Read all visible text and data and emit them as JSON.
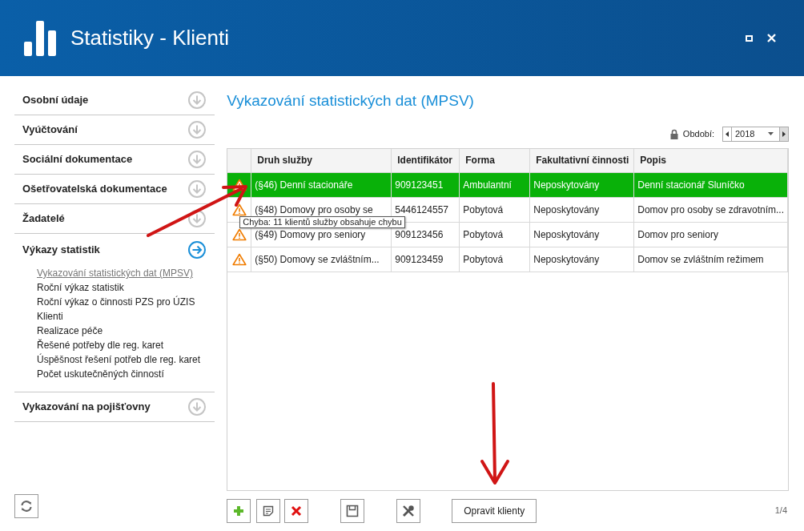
{
  "window": {
    "title": "Statistiky - Klienti"
  },
  "sidebar": {
    "sections": [
      {
        "title": "Osobní údaje",
        "expanded": false
      },
      {
        "title": "Vyúčtování",
        "expanded": false
      },
      {
        "title": "Sociální dokumentace",
        "expanded": false
      },
      {
        "title": "Ošetřovatelská dokumentace",
        "expanded": false
      },
      {
        "title": "Žadatelé",
        "expanded": false
      },
      {
        "title": "Výkazy statistik",
        "expanded": true,
        "items": [
          {
            "label": "Vykazování statistických dat (MPSV)",
            "selected": true
          },
          {
            "label": "Roční výkaz statistik",
            "selected": false
          },
          {
            "label": "Roční výkaz o činnosti PZS pro ÚZIS",
            "selected": false
          },
          {
            "label": "Klienti",
            "selected": false
          },
          {
            "label": "Realizace péče",
            "selected": false
          },
          {
            "label": "Řešené potřeby dle reg. karet",
            "selected": false
          },
          {
            "label": "Úspěšnost řešení potřeb dle reg. karet",
            "selected": false
          },
          {
            "label": "Počet uskutečněných činností",
            "selected": false
          }
        ]
      },
      {
        "title": "Vykazování na pojišťovny",
        "expanded": false
      }
    ]
  },
  "main": {
    "title": "Vykazování statistických dat (MPSV)",
    "period": {
      "label": "Období:",
      "value": "2018"
    }
  },
  "table": {
    "columns": [
      "Druh služby",
      "Identifikátor",
      "Forma",
      "Fakultativní činnosti",
      "Popis"
    ],
    "rows": [
      {
        "selected": true,
        "warning": true,
        "cells": [
          "(§46) Denní stacionáře",
          "909123451",
          "Ambulantní",
          "Neposkytovány",
          "Denní stacionář Sluníčko"
        ]
      },
      {
        "selected": false,
        "warning": true,
        "cells": [
          "(§48) Domovy pro osoby se",
          "5446124557",
          "Pobytová",
          "Neposkytovány",
          "Domov pro osoby se zdravotním..."
        ]
      },
      {
        "selected": false,
        "warning": true,
        "cells": [
          "(§49) Domovy pro seniory",
          "909123456",
          "Pobytová",
          "Neposkytovány",
          "Domov pro seniory"
        ]
      },
      {
        "selected": false,
        "warning": true,
        "cells": [
          "(§50) Domovy se zvláštním...",
          "909123459",
          "Pobytová",
          "Neposkytovány",
          "Domov se zvláštním režimem"
        ]
      }
    ]
  },
  "tooltip": "Chyba: 11 klientů služby obsahuje chybu",
  "toolbar": [
    {
      "kind": "add"
    },
    {
      "kind": "edit"
    },
    {
      "kind": "delete"
    },
    {
      "kind": "save"
    },
    {
      "kind": "tools"
    },
    {
      "kind": "text",
      "label": "Opravit klienty"
    }
  ],
  "pager": "1/4"
}
